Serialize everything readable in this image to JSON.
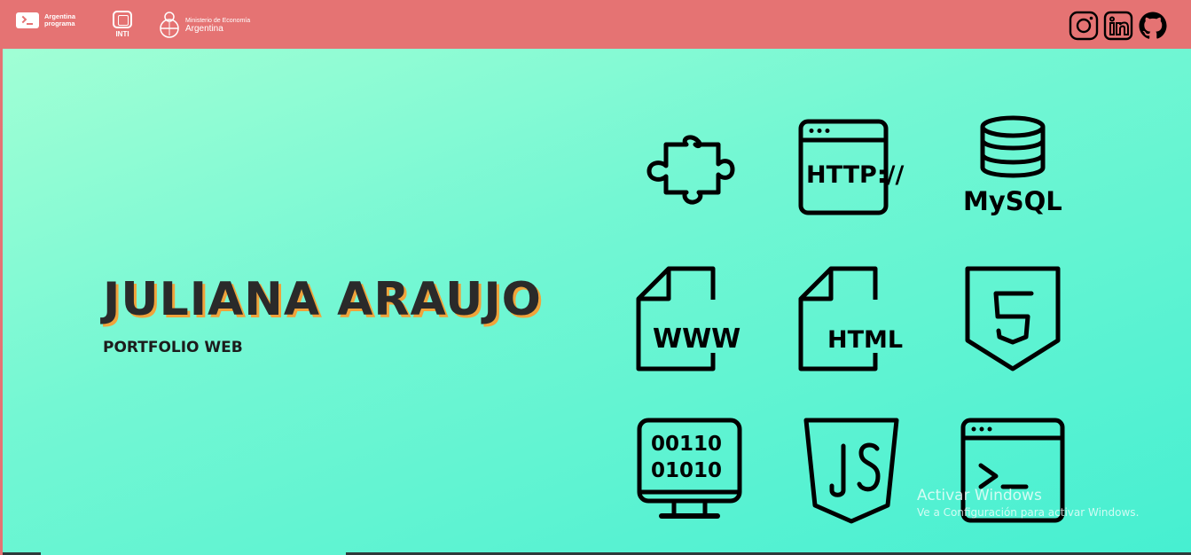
{
  "header": {
    "logos": {
      "argentina_programa": [
        "Argentina",
        "programa"
      ],
      "inti": "INTI",
      "ministerio": [
        "Ministerio de Economía",
        "Argentina"
      ]
    },
    "social": [
      {
        "name": "instagram-icon"
      },
      {
        "name": "linkedin-icon"
      },
      {
        "name": "github-icon"
      }
    ]
  },
  "hero": {
    "title": "JULIANA ARAUJO",
    "subtitle": "PORTFOLIO WEB",
    "tech_icons": [
      {
        "name": "puzzle-icon"
      },
      {
        "name": "http-icon",
        "label": "HTTP://"
      },
      {
        "name": "mysql-icon",
        "label": "MySQL"
      },
      {
        "name": "www-file-icon",
        "label": "WWW"
      },
      {
        "name": "html-file-icon",
        "label": "HTML"
      },
      {
        "name": "html5-icon",
        "label": "5"
      },
      {
        "name": "binary-monitor-icon",
        "lines": [
          "00110",
          "01010"
        ]
      },
      {
        "name": "javascript-icon",
        "label": "JS"
      },
      {
        "name": "terminal-icon",
        "label": ">_"
      }
    ]
  },
  "watermark": {
    "title": "Activar Windows",
    "subtitle": "Ve a Configuración para activar Windows."
  },
  "colors": {
    "header_bg": "#e57373",
    "hero_gradient_start": "#a1ffd5",
    "hero_gradient_end": "#46efd1",
    "title_shadow": "#f0a33b",
    "text_dark": "#2a2a2a"
  }
}
